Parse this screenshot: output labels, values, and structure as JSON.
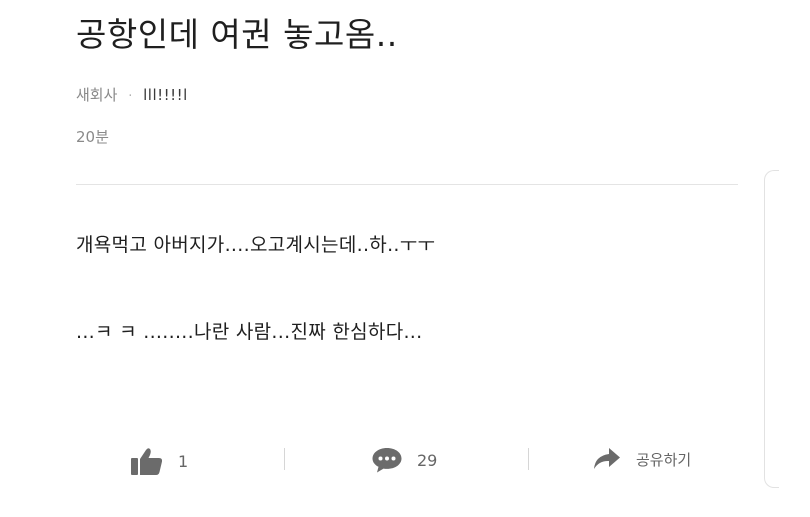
{
  "post": {
    "title": "공항인데 여권 놓고옴..",
    "category": "새회사",
    "separator": "·",
    "author": "lll!!!!l",
    "time": "20분",
    "body": [
      "개욕먹고 아버지가....오고계시는데..하..ㅜㅜ",
      "...ㅋ ㅋ ........나란 사람...진짜 한심하다..."
    ]
  },
  "actions": {
    "like_count": "1",
    "comment_count": "29",
    "share_label": "공유하기"
  },
  "icons": {
    "like": "thumbs-up-icon",
    "comment": "speech-bubble-icon",
    "share": "share-arrow-icon"
  },
  "colors": {
    "icon": "#6b6b6b",
    "text_muted": "#8a8a8a",
    "divider": "#e4e4e4"
  }
}
